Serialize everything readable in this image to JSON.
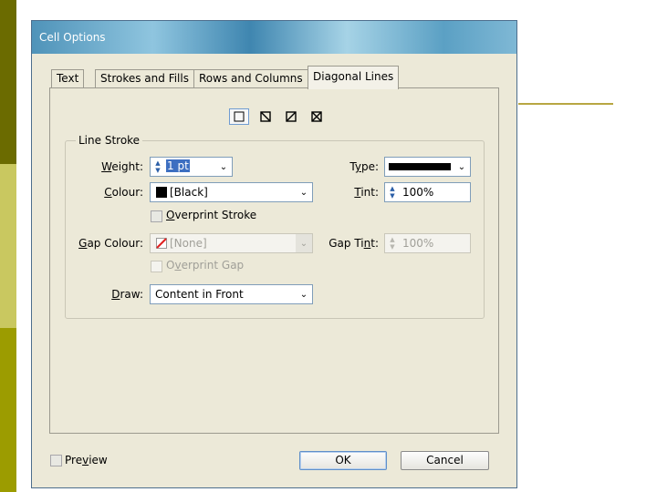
{
  "window": {
    "title": "Cell Options"
  },
  "tabs": [
    {
      "label": "Text",
      "active": false
    },
    {
      "label": "Strokes and Fills",
      "active": false
    },
    {
      "label": "Rows and Columns",
      "active": false
    },
    {
      "label": "Diagonal Lines",
      "active": true
    }
  ],
  "diagonal_buttons": [
    {
      "icon": "no-diagonal-icon",
      "selected": true
    },
    {
      "icon": "diagonal-down-icon",
      "selected": false
    },
    {
      "icon": "diagonal-up-icon",
      "selected": false
    },
    {
      "icon": "diagonal-cross-icon",
      "selected": false
    }
  ],
  "line_stroke": {
    "group_title": "Line Stroke",
    "weight": {
      "label_pre": "",
      "label_u": "W",
      "label_post": "eight:",
      "value": "1 pt"
    },
    "type": {
      "label_pre": "T",
      "label_u": "y",
      "label_post": "pe:"
    },
    "colour": {
      "label_pre": "",
      "label_u": "C",
      "label_post": "olour:",
      "value": "[Black]"
    },
    "tint": {
      "label_pre": "",
      "label_u": "T",
      "label_post": "int:",
      "value": "100%"
    },
    "overprint_stroke": {
      "label_pre": "",
      "label_u": "O",
      "label_post": "verprint Stroke"
    },
    "gap_colour": {
      "label_pre": "",
      "label_u": "G",
      "label_post": "ap Colour:",
      "value": "[None]"
    },
    "gap_tint": {
      "label_pre": "Gap Ti",
      "label_u": "n",
      "label_post": "t:",
      "value": "100%"
    },
    "overprint_gap": {
      "label_pre": "O",
      "label_u": "v",
      "label_post": "erprint Gap"
    },
    "draw": {
      "label_pre": "",
      "label_u": "D",
      "label_post": "raw:",
      "value": "Content in Front"
    }
  },
  "footer": {
    "preview": {
      "label_pre": "Pre",
      "label_u": "v",
      "label_post": "iew"
    },
    "ok_label": "OK",
    "cancel_label": "Cancel"
  },
  "colors": {
    "swatch_black": "#000000",
    "none_red": "#e02020",
    "accent": "#6f9bd1"
  }
}
